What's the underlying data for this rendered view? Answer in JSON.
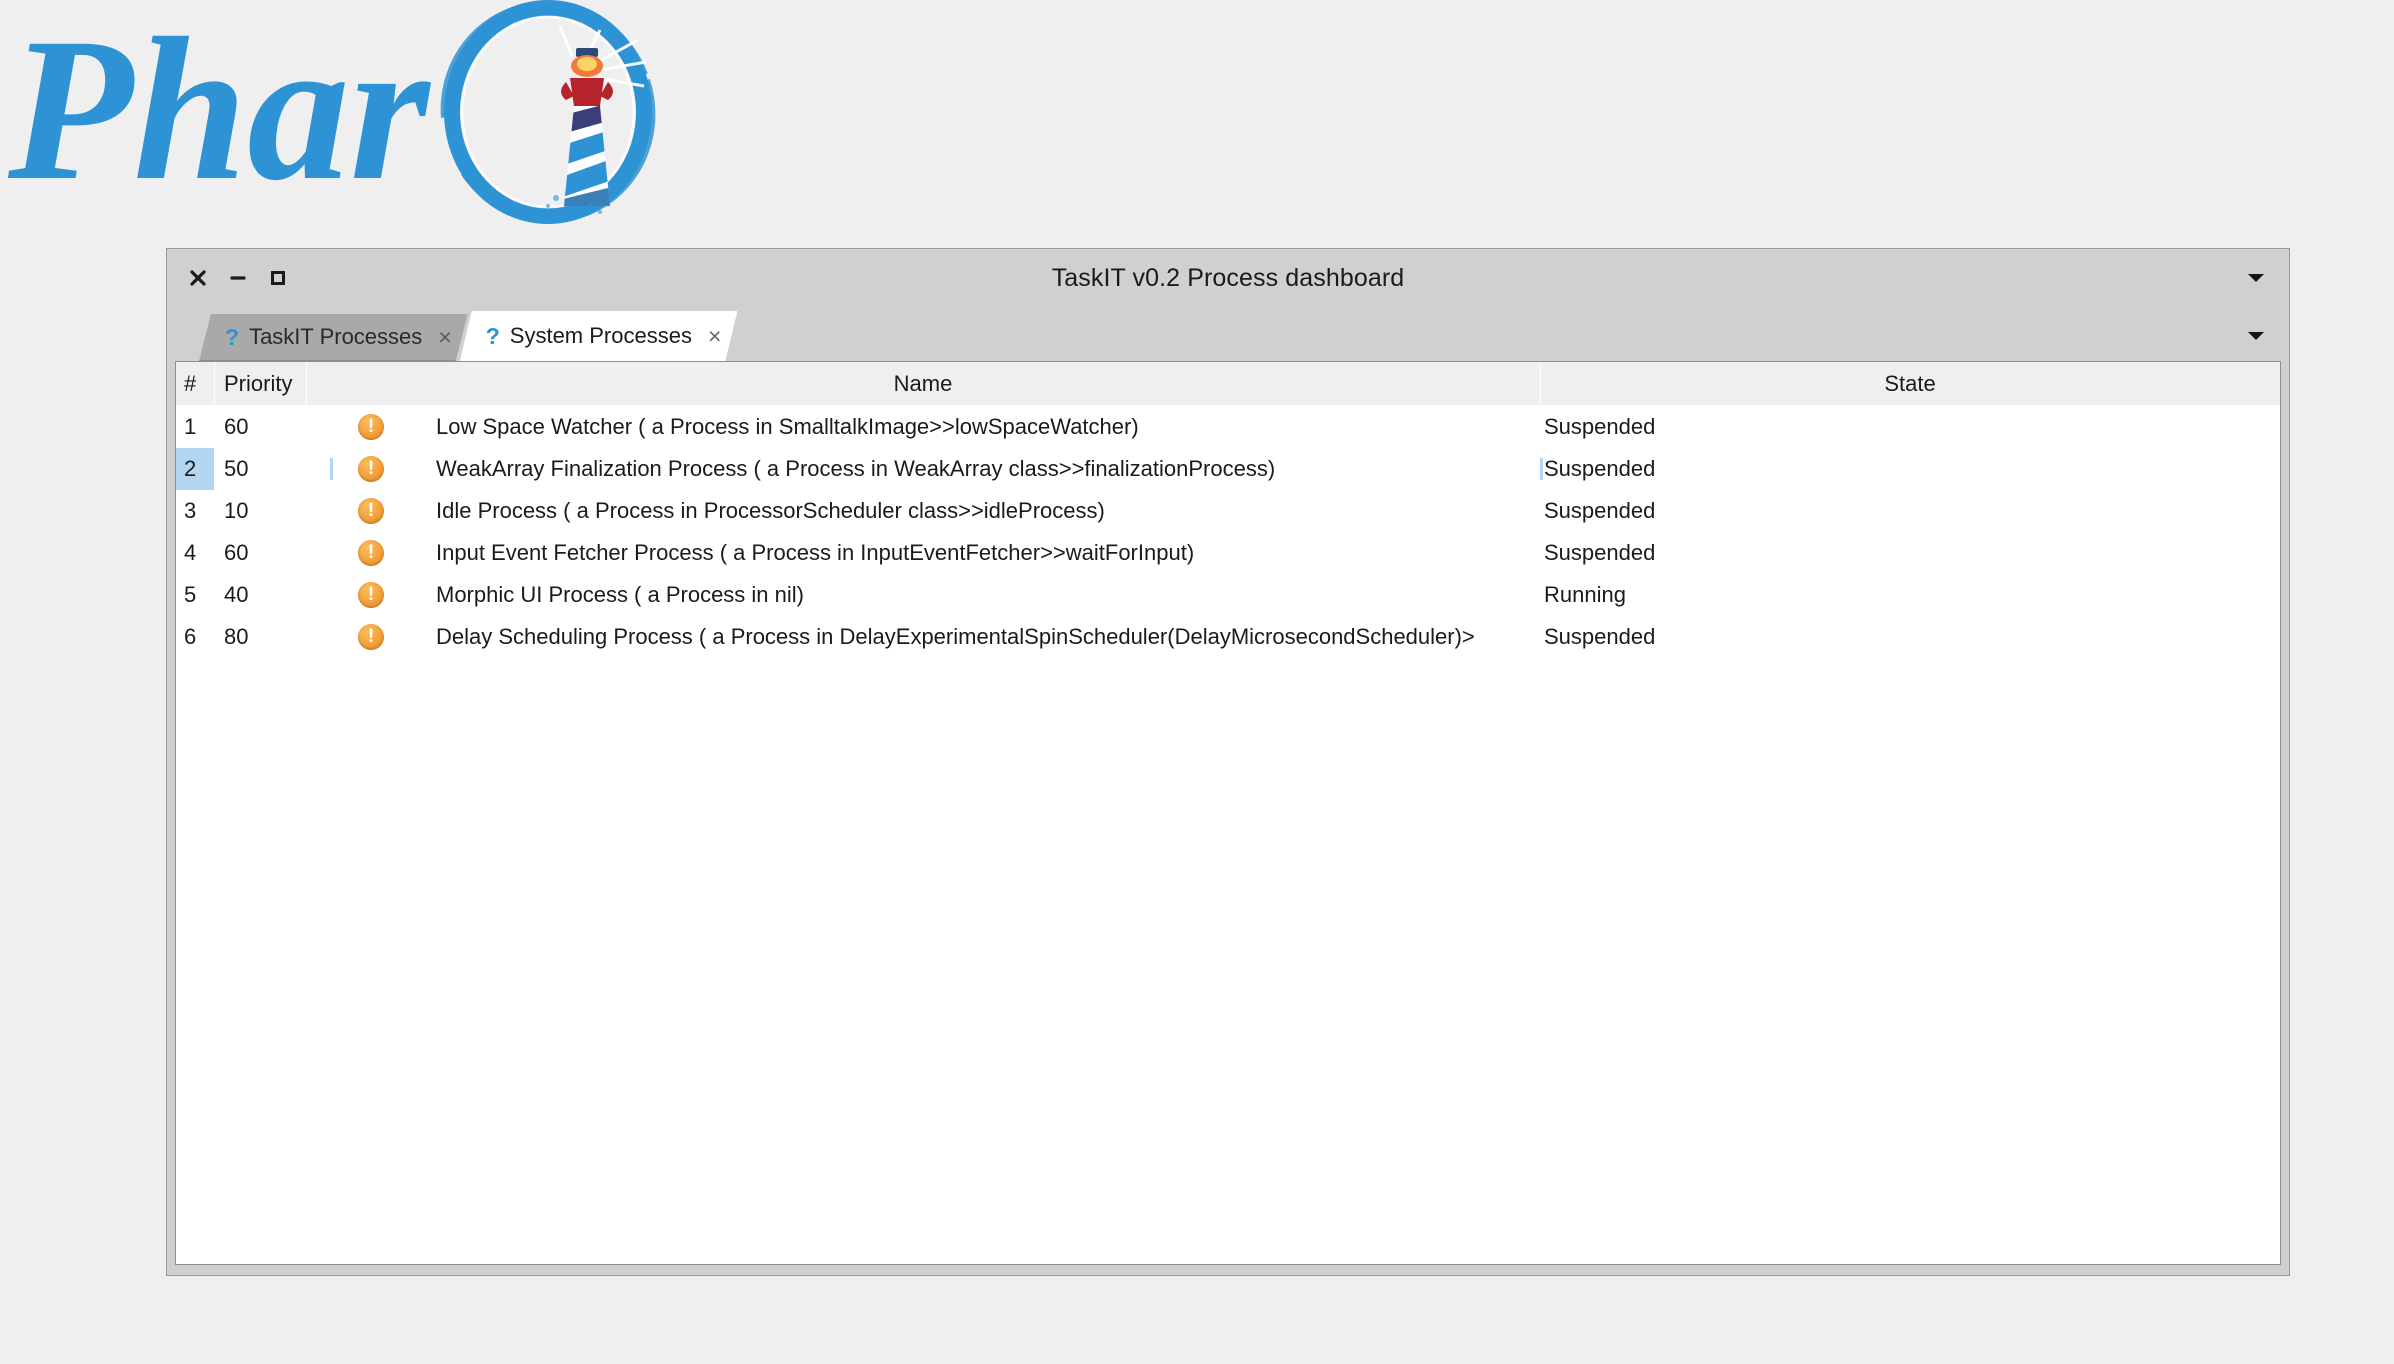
{
  "logo": {
    "wordmark": "Phar",
    "icon_name": "pharo-lighthouse-logo",
    "brand_color": "#2e93d4"
  },
  "window": {
    "title": "TaskIT v0.2 Process dashboard",
    "controls": {
      "close": "close-icon",
      "minimize": "minimize-icon",
      "maximize": "maximize-icon"
    },
    "titlebar_menu": "▼",
    "tabstrip_menu": "▼"
  },
  "tabs": [
    {
      "label": "TaskIT Processes",
      "badge": "?",
      "close": "×",
      "active": false
    },
    {
      "label": "System Processes",
      "badge": "?",
      "close": "×",
      "active": true
    }
  ],
  "table": {
    "columns": {
      "num": "#",
      "priority": "Priority",
      "icon": "",
      "name": "Name",
      "state": "State"
    },
    "rows": [
      {
        "num": "1",
        "priority": "60",
        "icon": "warning-icon",
        "name": "Low Space Watcher ( a Process in SmalltalkImage>>lowSpaceWatcher)",
        "state": "Suspended",
        "selected": false
      },
      {
        "num": "2",
        "priority": "50",
        "icon": "warning-icon",
        "name": "WeakArray Finalization Process ( a Process in WeakArray class>>finalizationProcess)",
        "state": "Suspended",
        "selected": true
      },
      {
        "num": "3",
        "priority": "10",
        "icon": "warning-icon",
        "name": "Idle Process ( a Process in ProcessorScheduler class>>idleProcess)",
        "state": "Suspended",
        "selected": false
      },
      {
        "num": "4",
        "priority": "60",
        "icon": "warning-icon",
        "name": "Input Event Fetcher Process ( a Process in InputEventFetcher>>waitForInput)",
        "state": "Suspended",
        "selected": false
      },
      {
        "num": "5",
        "priority": "40",
        "icon": "warning-icon",
        "name": "Morphic UI Process ( a Process in nil)",
        "state": "Running",
        "selected": false
      },
      {
        "num": "6",
        "priority": "80",
        "icon": "warning-icon",
        "name": "Delay Scheduling Process ( a Process in DelayExperimentalSpinScheduler(DelayMicrosecondScheduler)>",
        "state": "Suspended",
        "selected": false
      }
    ]
  },
  "colors": {
    "selection": "#b3d7f2",
    "titlebar": "#d0d0d0",
    "page_bg": "#efefef",
    "warning": "#f2a03c"
  }
}
